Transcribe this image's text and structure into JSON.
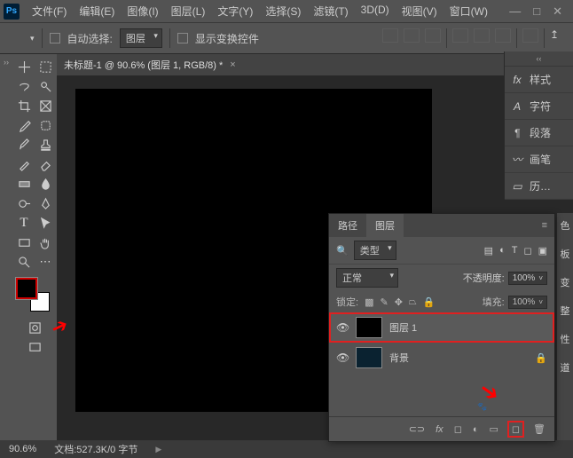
{
  "app": {
    "logo": "Ps"
  },
  "menu": [
    "文件(F)",
    "编辑(E)",
    "图像(I)",
    "图层(L)",
    "文字(Y)",
    "选择(S)",
    "滤镜(T)",
    "3D(D)",
    "视图(V)",
    "窗口(W)"
  ],
  "window_buttons": {
    "min": "—",
    "max": "□",
    "close": "✕"
  },
  "optbar": {
    "auto_select": "自动选择:",
    "layer_dd": "图层",
    "show_transform": "显示变换控件"
  },
  "doc": {
    "tab": "未标题-1 @ 90.6% (图层 1, RGB/8) *"
  },
  "rpanels": [
    "样式",
    "字符",
    "段落",
    "画笔",
    "历…"
  ],
  "rstrip": [
    "色",
    "板",
    "变",
    "整",
    "性",
    "道"
  ],
  "layer_panel": {
    "tab_path": "路径",
    "tab_layer": "图层",
    "kind": "类型",
    "blend": "正常",
    "opacity_label": "不透明度:",
    "opacity": "100%",
    "lock_label": "锁定:",
    "fill_label": "填充:",
    "fill": "100%",
    "layers": [
      {
        "name": "图层 1",
        "thumb": "#000",
        "selected": true,
        "highlight": true
      },
      {
        "name": "背景",
        "thumb": "#0a2230",
        "locked": true
      }
    ]
  },
  "status": {
    "zoom": "90.6%",
    "doc": "文档:527.3K/0 字节"
  }
}
